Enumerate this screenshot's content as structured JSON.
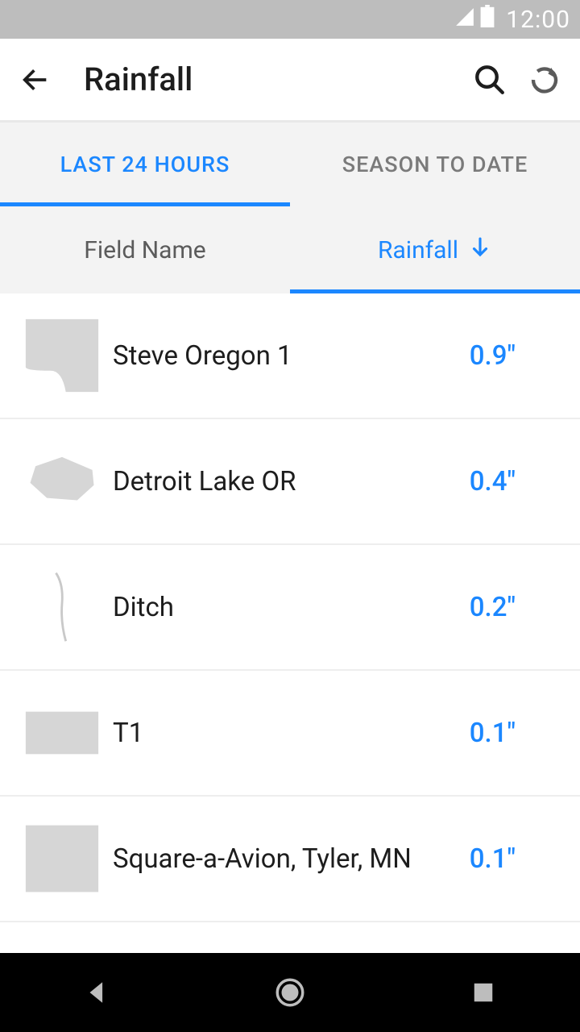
{
  "status": {
    "time": "12:00"
  },
  "appbar": {
    "title": "Rainfall"
  },
  "tabs": {
    "last24": "LAST 24 HOURS",
    "season": "SEASON TO DATE"
  },
  "sort": {
    "field_name": "Field Name",
    "rainfall": "Rainfall"
  },
  "rows": [
    {
      "name": "Steve Oregon 1",
      "value": "0.9\""
    },
    {
      "name": "Detroit Lake OR",
      "value": "0.4\""
    },
    {
      "name": "Ditch",
      "value": "0.2\""
    },
    {
      "name": "T1",
      "value": "0.1\""
    },
    {
      "name": "Square-a-Avion, Tyler, MN",
      "value": "0.1\""
    }
  ]
}
